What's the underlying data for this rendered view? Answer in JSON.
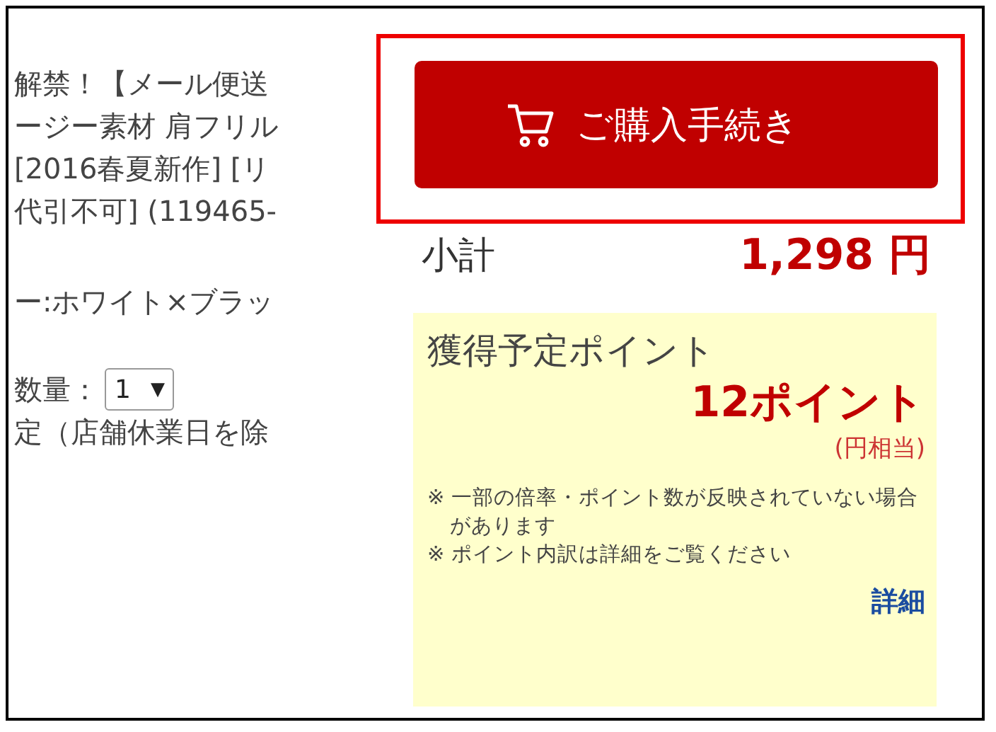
{
  "product_lines": [
    "解禁！【メール便送",
    "ージー素材 肩フリル",
    "[2016春夏新作] [リ",
    "代引不可] (119465-"
  ],
  "color_line": "ー:ホワイト×ブラッ",
  "quantity": {
    "label": "数量：",
    "value": "1",
    "arrow": "▼"
  },
  "delivery_line": "定（店舗休業日を除",
  "checkout_button": "ご購入手続き",
  "subtotal": {
    "label": "小計",
    "amount": "1,298 円"
  },
  "points": {
    "title": "獲得予定ポイント",
    "value": "12ポイント",
    "equivalent": "(円相当)",
    "notes": [
      "※ 一部の倍率・ポイント数が反映されていない場合があります",
      "※ ポイント内訳は詳細をご覧ください"
    ],
    "detail_link": "詳細"
  }
}
